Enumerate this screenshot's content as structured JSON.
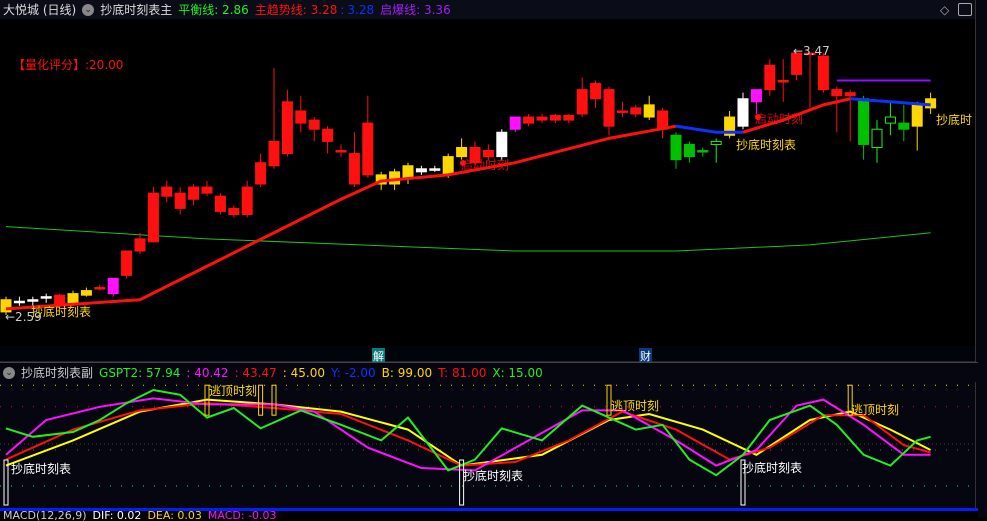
{
  "header": {
    "stock": "大悦城 (日线)",
    "indicator": "抄底时刻表主",
    "balance_label": "平衡线: 2.86",
    "trend_label": "主趋势线: 3.28",
    "trend_sep": ":",
    "trend_value2": "3.28",
    "burst_label": "启爆线: 3.36"
  },
  "main": {
    "score": "【量化评分】:20.00",
    "low_label": "←2.59",
    "high_label": "←3.47",
    "buy_label": "抄底时刻表",
    "start_label": "启动时刻",
    "buy_label_cut": "抄底时",
    "marker1": "解",
    "marker2": "财"
  },
  "sub": {
    "title": "抄底时刻表副",
    "gspt": "GSPT2: 57.94",
    "v2": ": 40.42",
    "v3": ": 43.47",
    "v4": ": 45.00",
    "y": "Y: -2.00",
    "b": "B: 99.00",
    "t": "T: 81.00",
    "x": "X: 15.00",
    "buy_label": "抄底时刻表",
    "top_label": "逃顶时刻"
  },
  "macd": {
    "title": "MACD(12,26,9)",
    "dif": "DIF: 0.02",
    "dea": "DEA: 0.03",
    "macd": "MACD: -0.03"
  },
  "colors": {
    "red": "#ff1010",
    "yellow": "#ffd700",
    "white": "#ffffff",
    "magenta": "#ff10ff",
    "green": "#00c000",
    "blue": "#1030ff",
    "purple": "#9010ff",
    "lime": "#22ee22"
  },
  "chart_data": {
    "type": "candlestick",
    "price_range": [
      2.59,
      3.47
    ],
    "candles": [
      [
        2.61,
        2.65,
        2.66,
        2.6,
        "yellow"
      ],
      [
        2.64,
        2.645,
        2.66,
        2.63,
        "white"
      ],
      [
        2.645,
        2.65,
        2.66,
        2.63,
        "white"
      ],
      [
        2.655,
        2.66,
        2.67,
        2.64,
        "white"
      ],
      [
        2.63,
        2.665,
        2.67,
        2.62,
        "red"
      ],
      [
        2.64,
        2.67,
        2.68,
        2.63,
        "yellow"
      ],
      [
        2.665,
        2.68,
        2.69,
        2.66,
        "yellow"
      ],
      [
        2.69,
        2.69,
        2.7,
        2.68,
        "red"
      ],
      [
        2.67,
        2.72,
        2.72,
        2.66,
        "magenta"
      ],
      [
        2.73,
        2.81,
        2.81,
        2.72,
        "red"
      ],
      [
        2.81,
        2.85,
        2.87,
        2.8,
        "red"
      ],
      [
        2.84,
        3.0,
        3.02,
        2.84,
        "red"
      ],
      [
        2.99,
        3.02,
        3.04,
        2.97,
        "red"
      ],
      [
        3.0,
        2.95,
        3.02,
        2.93,
        "red"
      ],
      [
        2.98,
        3.02,
        3.03,
        2.96,
        "red"
      ],
      [
        3.02,
        3.0,
        3.04,
        2.99,
        "red"
      ],
      [
        2.99,
        2.94,
        3.0,
        2.93,
        "red"
      ],
      [
        2.95,
        2.93,
        2.96,
        2.92,
        "red"
      ],
      [
        2.93,
        3.02,
        3.04,
        2.92,
        "red"
      ],
      [
        3.03,
        3.1,
        3.13,
        3.02,
        "red"
      ],
      [
        3.09,
        3.17,
        3.41,
        3.08,
        "red"
      ],
      [
        3.13,
        3.3,
        3.34,
        3.12,
        "red"
      ],
      [
        3.27,
        3.23,
        3.32,
        3.2,
        "red"
      ],
      [
        3.24,
        3.21,
        3.25,
        3.17,
        "red"
      ],
      [
        3.21,
        3.17,
        3.22,
        3.13,
        "red"
      ],
      [
        3.14,
        3.14,
        3.16,
        3.12,
        "red"
      ],
      [
        3.13,
        3.03,
        3.2,
        3.02,
        "red"
      ],
      [
        3.06,
        3.23,
        3.32,
        3.05,
        "red"
      ],
      [
        3.06,
        3.03,
        3.07,
        3.01,
        "yellow"
      ],
      [
        3.07,
        3.03,
        3.08,
        3.01,
        "yellow"
      ],
      [
        3.05,
        3.09,
        3.1,
        3.03,
        "yellow"
      ],
      [
        3.07,
        3.08,
        3.09,
        3.06,
        "white"
      ],
      [
        3.075,
        3.08,
        3.09,
        3.07,
        "white"
      ],
      [
        3.06,
        3.12,
        3.13,
        3.05,
        "yellow"
      ],
      [
        3.12,
        3.15,
        3.18,
        3.11,
        "yellow"
      ],
      [
        3.15,
        3.1,
        3.17,
        3.09,
        "red"
      ],
      [
        3.14,
        3.12,
        3.16,
        3.11,
        "red"
      ],
      [
        3.12,
        3.2,
        3.21,
        3.11,
        "white"
      ],
      [
        3.21,
        3.25,
        3.25,
        3.2,
        "magenta"
      ],
      [
        3.23,
        3.25,
        3.26,
        3.22,
        "red"
      ],
      [
        3.24,
        3.25,
        3.26,
        3.23,
        "red"
      ],
      [
        3.24,
        3.255,
        3.26,
        3.23,
        "red"
      ],
      [
        3.24,
        3.255,
        3.26,
        3.23,
        "red"
      ],
      [
        3.26,
        3.34,
        3.38,
        3.25,
        "red"
      ],
      [
        3.36,
        3.31,
        3.37,
        3.28,
        "red"
      ],
      [
        3.34,
        3.22,
        3.35,
        3.19,
        "red"
      ],
      [
        3.27,
        3.27,
        3.3,
        3.25,
        "red"
      ],
      [
        3.26,
        3.28,
        3.29,
        3.25,
        "red"
      ],
      [
        3.25,
        3.29,
        3.32,
        3.24,
        "yellow"
      ],
      [
        3.27,
        3.21,
        3.28,
        3.18,
        "red"
      ],
      [
        3.19,
        3.11,
        3.2,
        3.08,
        "green"
      ],
      [
        3.16,
        3.12,
        3.17,
        3.1,
        "green"
      ],
      [
        3.14,
        3.14,
        3.15,
        3.12,
        "green"
      ],
      [
        3.16,
        3.17,
        3.18,
        3.1,
        "hollow"
      ],
      [
        3.19,
        3.25,
        3.27,
        3.18,
        "yellow"
      ],
      [
        3.22,
        3.31,
        3.33,
        3.21,
        "white"
      ],
      [
        3.3,
        3.34,
        3.34,
        3.26,
        "magenta"
      ],
      [
        3.34,
        3.42,
        3.44,
        3.32,
        "red"
      ],
      [
        3.37,
        3.37,
        3.44,
        3.3,
        "red"
      ],
      [
        3.39,
        3.46,
        3.46,
        3.37,
        "red"
      ],
      [
        3.46,
        3.46,
        3.46,
        3.28,
        "red"
      ],
      [
        3.45,
        3.34,
        3.46,
        3.33,
        "red"
      ],
      [
        3.34,
        3.32,
        3.35,
        3.2,
        "red"
      ],
      [
        3.33,
        3.32,
        3.34,
        3.17,
        "red"
      ],
      [
        3.31,
        3.16,
        3.32,
        3.11,
        "green"
      ],
      [
        3.15,
        3.21,
        3.24,
        3.1,
        "hollow"
      ],
      [
        3.23,
        3.25,
        3.3,
        3.19,
        "hollow"
      ],
      [
        3.23,
        3.21,
        3.29,
        3.17,
        "green"
      ],
      [
        3.22,
        3.29,
        3.3,
        3.14,
        "yellow"
      ],
      [
        3.28,
        3.31,
        3.33,
        3.26,
        "yellow"
      ]
    ],
    "trend_line": [
      [
        0,
        2.62
      ],
      [
        10,
        2.65
      ],
      [
        15,
        2.76
      ],
      [
        20,
        2.87
      ],
      [
        25,
        2.98
      ],
      [
        28,
        3.04
      ],
      [
        33,
        3.06
      ],
      [
        38,
        3.1
      ],
      [
        45,
        3.18
      ],
      [
        50,
        3.22
      ]
    ],
    "trend_blue_1": [
      [
        50,
        3.22
      ],
      [
        53,
        3.2
      ],
      [
        55,
        3.2
      ]
    ],
    "trend_line_2": [
      [
        55,
        3.2
      ],
      [
        58,
        3.24
      ],
      [
        61,
        3.29
      ],
      [
        63,
        3.31
      ]
    ],
    "trend_blue_2": [
      [
        63,
        3.31
      ],
      [
        66,
        3.3
      ],
      [
        69,
        3.29
      ]
    ],
    "balance_line": [
      [
        0,
        2.89
      ],
      [
        15,
        2.85
      ],
      [
        38,
        2.81
      ],
      [
        50,
        2.81
      ],
      [
        60,
        2.83
      ],
      [
        69,
        2.87
      ]
    ],
    "burst_line": [
      [
        62,
        3.37
      ],
      [
        69,
        3.37
      ]
    ],
    "sub_range": [
      15,
      99
    ],
    "sub_series": [
      {
        "name": "yellow",
        "points": [
          [
            0,
            32
          ],
          [
            5,
            53
          ],
          [
            10,
            77
          ],
          [
            15,
            87
          ],
          [
            20,
            83
          ],
          [
            25,
            77
          ],
          [
            30,
            62
          ],
          [
            34,
            32
          ],
          [
            40,
            41
          ],
          [
            45,
            70
          ],
          [
            48,
            75
          ],
          [
            52,
            62
          ],
          [
            56,
            41
          ],
          [
            60,
            70
          ],
          [
            63,
            77
          ],
          [
            66,
            62
          ],
          [
            69,
            45
          ]
        ]
      },
      {
        "name": "red",
        "points": [
          [
            0,
            37
          ],
          [
            5,
            62
          ],
          [
            10,
            78
          ],
          [
            15,
            84
          ],
          [
            20,
            80
          ],
          [
            25,
            75
          ],
          [
            30,
            53
          ],
          [
            34,
            32
          ],
          [
            38,
            35
          ],
          [
            42,
            53
          ],
          [
            46,
            77
          ],
          [
            50,
            62
          ],
          [
            54,
            37
          ],
          [
            57,
            47
          ],
          [
            61,
            74
          ],
          [
            64,
            74
          ],
          [
            67,
            49
          ],
          [
            69,
            43
          ]
        ]
      },
      {
        "name": "magenta",
        "points": [
          [
            0,
            41
          ],
          [
            3,
            70
          ],
          [
            7,
            81
          ],
          [
            11,
            88
          ],
          [
            15,
            83
          ],
          [
            20,
            83
          ],
          [
            23,
            77
          ],
          [
            27,
            47
          ],
          [
            31,
            30
          ],
          [
            35,
            28
          ],
          [
            39,
            53
          ],
          [
            43,
            78
          ],
          [
            46,
            78
          ],
          [
            50,
            53
          ],
          [
            53,
            32
          ],
          [
            56,
            45
          ],
          [
            59,
            82
          ],
          [
            61,
            87
          ],
          [
            64,
            66
          ],
          [
            67,
            41
          ],
          [
            69,
            41
          ]
        ]
      },
      {
        "name": "lime",
        "points": [
          [
            0,
            63
          ],
          [
            2,
            56
          ],
          [
            5,
            60
          ],
          [
            7,
            70
          ],
          [
            9,
            84
          ],
          [
            11,
            95
          ],
          [
            13,
            91
          ],
          [
            15,
            72
          ],
          [
            17,
            80
          ],
          [
            19,
            63
          ],
          [
            22,
            78
          ],
          [
            25,
            66
          ],
          [
            28,
            53
          ],
          [
            30,
            72
          ],
          [
            33,
            28
          ],
          [
            35,
            37
          ],
          [
            37,
            63
          ],
          [
            40,
            53
          ],
          [
            43,
            82
          ],
          [
            45,
            72
          ],
          [
            47,
            62
          ],
          [
            49,
            66
          ],
          [
            51,
            37
          ],
          [
            53,
            24
          ],
          [
            55,
            41
          ],
          [
            57,
            70
          ],
          [
            60,
            82
          ],
          [
            62,
            66
          ],
          [
            64,
            41
          ],
          [
            66,
            32
          ],
          [
            68,
            53
          ],
          [
            69,
            56
          ]
        ]
      }
    ],
    "buy_markers": [
      0,
      34,
      55
    ],
    "top_markers": [
      15,
      19,
      20,
      45,
      63
    ]
  }
}
